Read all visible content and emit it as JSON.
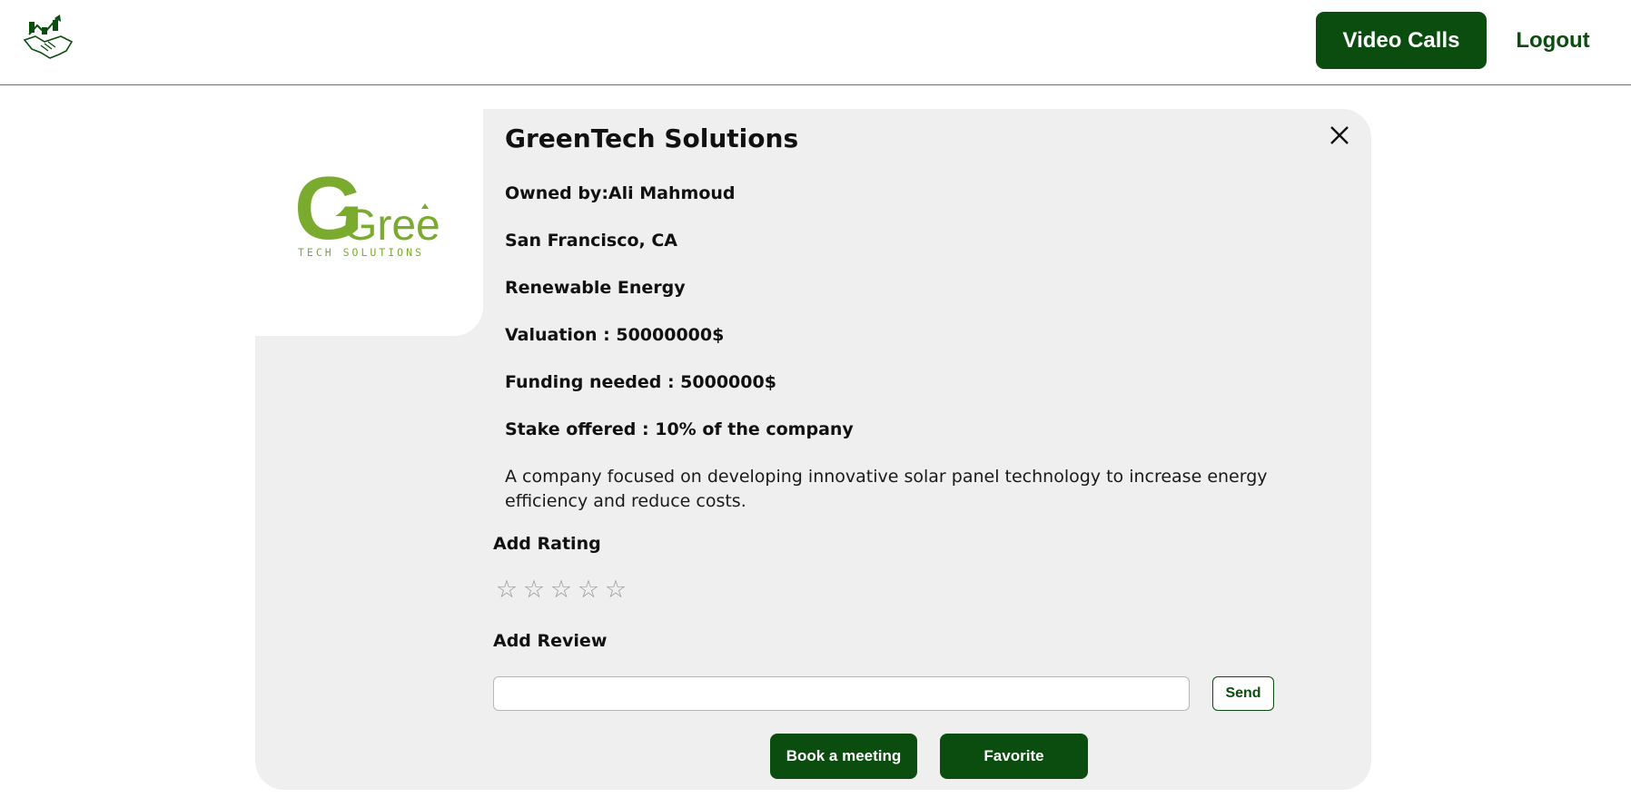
{
  "header": {
    "logo_icon": "growth-chart-handshake-icon",
    "video_calls_label": "Video Calls",
    "logout_label": "Logout"
  },
  "colors": {
    "brand": "#0b4d0f",
    "card_background": "#efefef",
    "logo_green": "#7aab2e",
    "star_empty": "#9a9a9a"
  },
  "company": {
    "logo_word": "Green",
    "logo_tagline": "TECH SOLUTIONS",
    "name": "GreenTech Solutions",
    "owner": "Owned by:Ali Mahmoud",
    "location": "San Francisco, CA",
    "industry": "Renewable Energy",
    "valuation": "Valuation : 50000000$",
    "funding_needed": "Funding needed : 5000000$",
    "stake_offered": "Stake offered : 10% of the company",
    "description": "A company focused on developing innovative solar panel technology to increase energy efficiency and reduce costs."
  },
  "rating": {
    "label": "Add Rating",
    "max_stars": 5,
    "current_rating": 0,
    "star_glyph": "☆"
  },
  "review": {
    "label": "Add Review",
    "value": "",
    "placeholder": "",
    "send_label": "Send"
  },
  "actions": {
    "book_label": "Book a meeting",
    "favorite_label": "Favorite"
  },
  "close_icon": "close-icon"
}
